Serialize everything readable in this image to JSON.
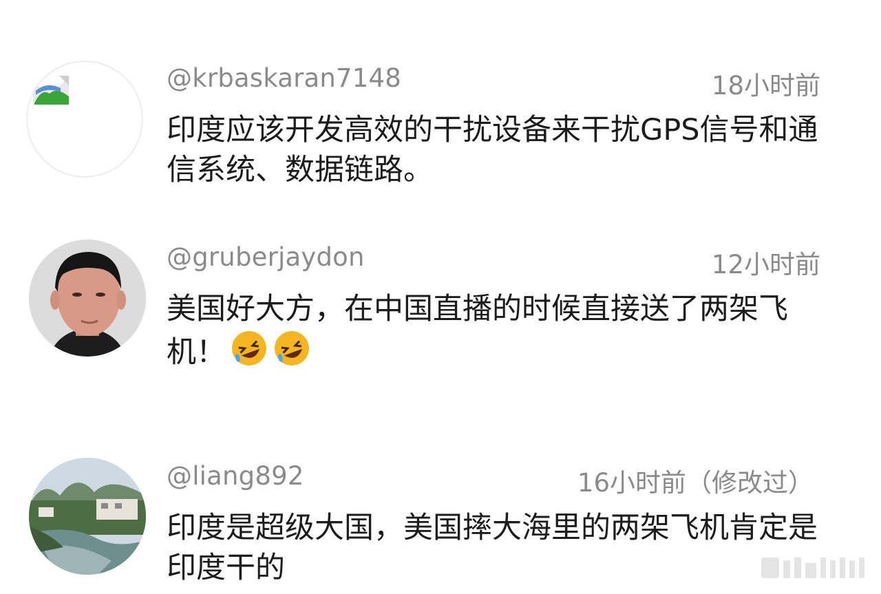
{
  "comments": [
    {
      "username": "@krbaskaran7148",
      "time": "18小时前",
      "text": "印度应该开发高效的干扰设备来干扰GPS信号和通信系统、数据链路。",
      "avatar_icon": "broken-image-icon"
    },
    {
      "username": "@gruberjaydon",
      "time": "12小时前",
      "text": "美国好大方，在中国直播的时候直接送了两架飞机！",
      "emojis": [
        "rofl-emoji",
        "rofl-emoji"
      ],
      "avatar_icon": "person-photo"
    },
    {
      "username": "@liang892",
      "time": "16小时前（修改过）",
      "text": "印度是超级大国，美国摔大海里的两架飞机肯定是印度干的",
      "avatar_icon": "landscape-photo"
    }
  ],
  "colors": {
    "meta_text": "#8a8a8a",
    "body_text": "#1c1c1c",
    "emoji_face": "#f5b521"
  }
}
